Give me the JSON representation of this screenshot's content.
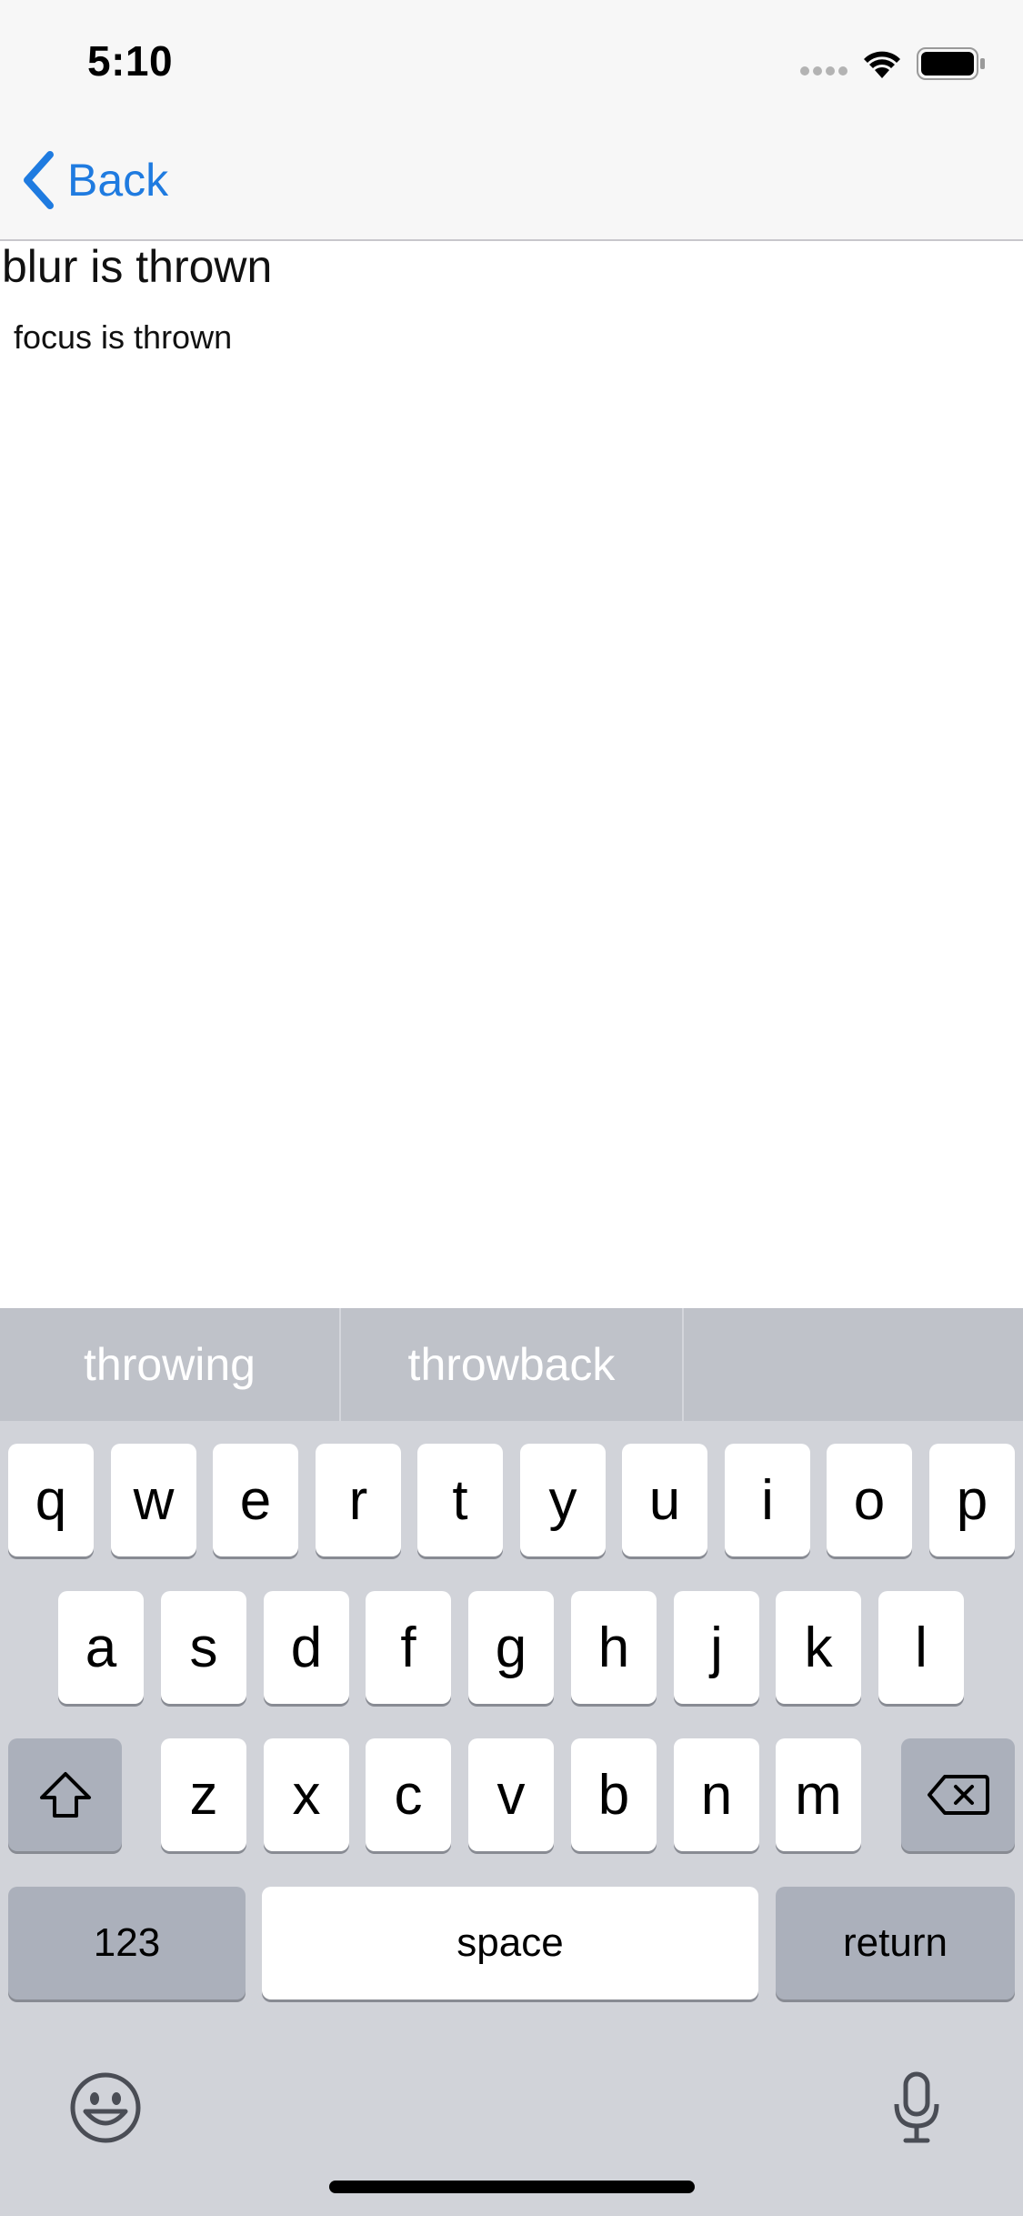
{
  "status_bar": {
    "time": "5:10"
  },
  "nav": {
    "back_label": "Back"
  },
  "content": {
    "blur_text": "blur is thrown",
    "focus_text": "focus is thrown"
  },
  "keyboard": {
    "suggestions": [
      "throwing",
      "throwback",
      ""
    ],
    "row1": [
      "q",
      "w",
      "e",
      "r",
      "t",
      "y",
      "u",
      "i",
      "o",
      "p"
    ],
    "row2": [
      "a",
      "s",
      "d",
      "f",
      "g",
      "h",
      "j",
      "k",
      "l"
    ],
    "row3": [
      "z",
      "x",
      "c",
      "v",
      "b",
      "n",
      "m"
    ],
    "numbers_label": "123",
    "space_label": "space",
    "return_label": "return"
  },
  "colors": {
    "accent": "#1f7be0",
    "keyboard_bg": "#d1d3d9",
    "suggestion_bar": "#bfc2c9",
    "key_dark": "#abb0bb"
  }
}
